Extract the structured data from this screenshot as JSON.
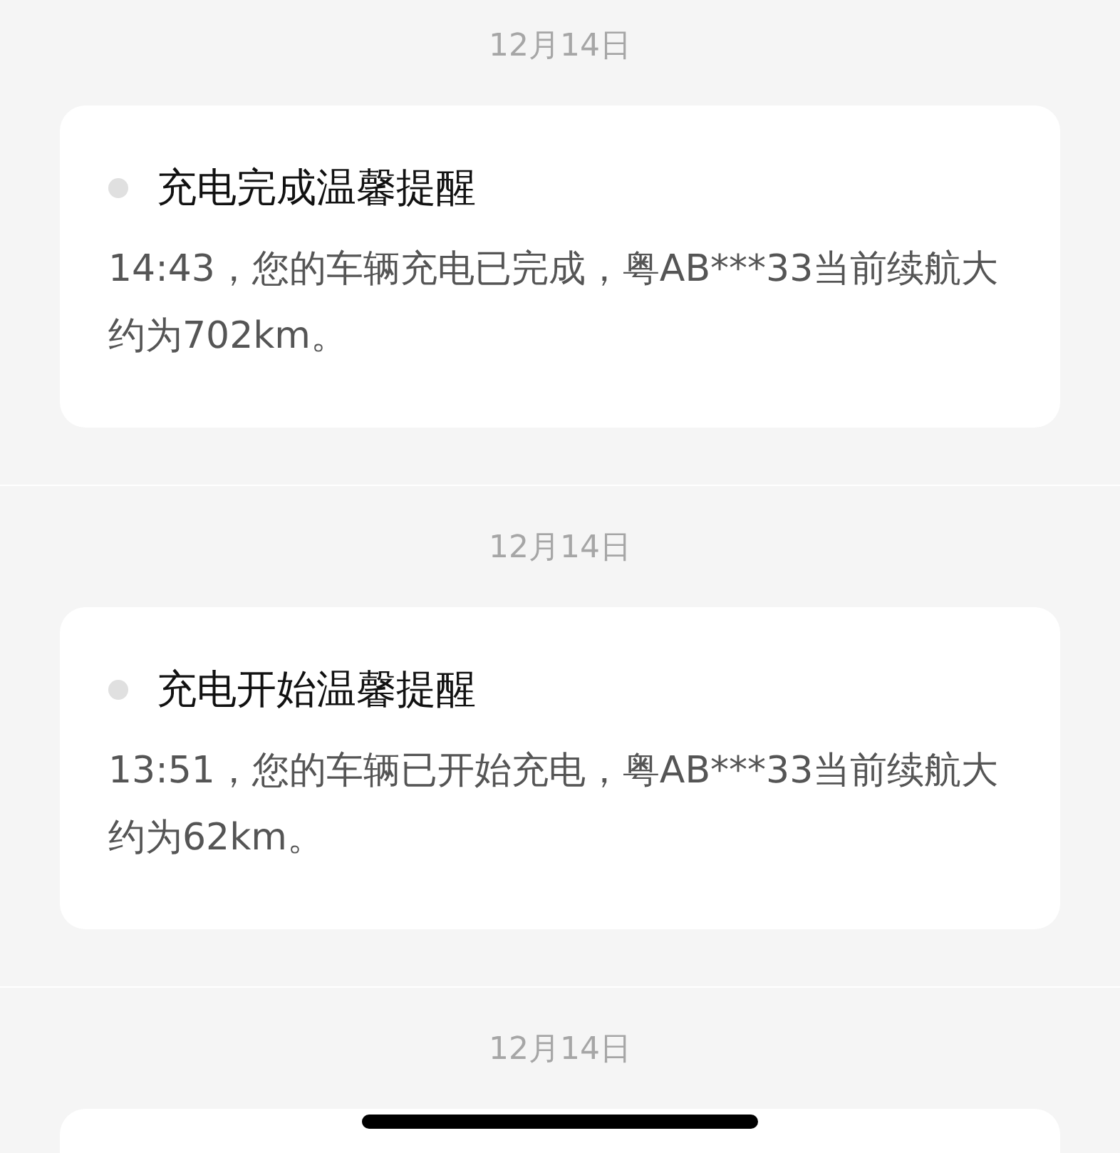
{
  "messages": [
    {
      "date": "12月14日",
      "title": "充电完成温馨提醒",
      "body": "14:43，您的车辆充电已完成，粤AB***33当前续航大约为702km。"
    },
    {
      "date": "12月14日",
      "title": "充电开始温馨提醒",
      "body": "13:51，您的车辆已开始充电，粤AB***33当前续航大约为62km。"
    },
    {
      "date": "12月14日"
    }
  ]
}
